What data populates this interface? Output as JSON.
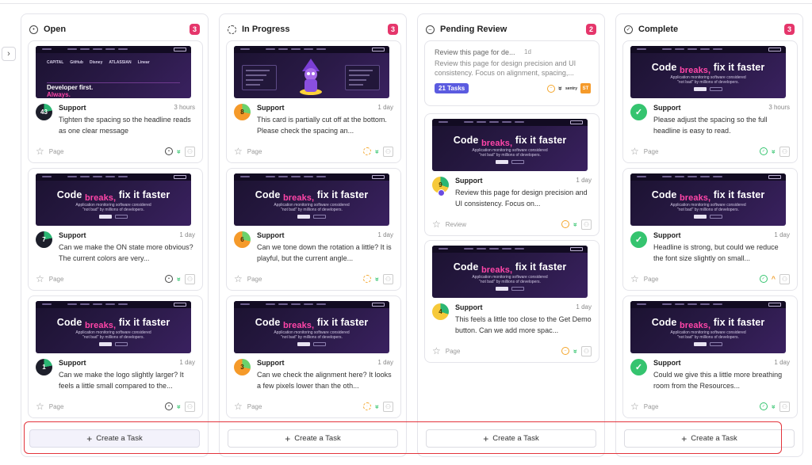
{
  "columns": [
    {
      "title": "Open",
      "icon": "open-status-icon",
      "count": "3",
      "create_label": "Create a Task",
      "cards": [
        {
          "thumb": "logos",
          "avatar": "43",
          "avatar_style": "dark",
          "category": "Support",
          "time": "3 hours",
          "description": "Tighten the spacing so the headline reads as one clear message",
          "type": "Page",
          "status": "open",
          "priority": "low"
        },
        {
          "thumb": "hero",
          "avatar": "7",
          "avatar_style": "dark",
          "category": "Support",
          "time": "1 day",
          "description": "Can we make the ON state more obvious? The current colors are very...",
          "type": "Page",
          "status": "open",
          "priority": "low"
        },
        {
          "thumb": "hero",
          "avatar": "1",
          "avatar_style": "dark",
          "category": "Support",
          "time": "1 day",
          "description": "Can we make the logo slightly larger? It feels a little small compared to the...",
          "type": "Page",
          "status": "open",
          "priority": "low"
        }
      ]
    },
    {
      "title": "In Progress",
      "icon": "in-progress-status-icon",
      "count": "3",
      "create_label": "Create a Task",
      "cards": [
        {
          "thumb": "mascot",
          "avatar": "8",
          "avatar_style": "orange",
          "category": "Support",
          "time": "1 day",
          "description": "This card is partially cut off at the bottom. Please check the spacing an...",
          "type": "Page",
          "status": "progress",
          "priority": "low"
        },
        {
          "thumb": "hero",
          "avatar": "6",
          "avatar_style": "orange",
          "category": "Support",
          "time": "1 day",
          "description": "Can we tone down the rotation a little? It is playful, but the current angle...",
          "type": "Page",
          "status": "progress",
          "priority": "low"
        },
        {
          "thumb": "hero",
          "avatar": "3",
          "avatar_style": "orange",
          "category": "Support",
          "time": "1 day",
          "description": "Can we check the alignment here? It looks a few pixels lower than the oth...",
          "type": "Page",
          "status": "progress",
          "priority": "low"
        }
      ]
    },
    {
      "title": "Pending Review",
      "icon": "pending-review-status-icon",
      "count": "2",
      "create_label": "Create a Task",
      "review_card": {
        "title": "Review this page for de...",
        "time": "1d",
        "description": "Review this page for design precision and UI consistency. Focus on alignment, spacing,...",
        "tasks": "21 Tasks",
        "assignee": "ST",
        "logo": "sentry"
      },
      "cards": [
        {
          "thumb": "hero",
          "avatar": "9",
          "avatar_style": "yellow",
          "category": "Support",
          "time": "1 day",
          "description": "Review this page for design precision and UI consistency. Focus on...",
          "type": "Review",
          "status": "pending",
          "priority": "low"
        },
        {
          "thumb": "hero",
          "avatar": "4",
          "avatar_style": "yellow",
          "category": "Support",
          "time": "1 day",
          "description": "This feels a little too close to the Get Demo button. Can we add more spac...",
          "type": "Page",
          "status": "pending",
          "priority": "low"
        }
      ]
    },
    {
      "title": "Complete",
      "icon": "complete-status-icon",
      "count": "3",
      "create_label": "Create a Task",
      "cards": [
        {
          "thumb": "hero",
          "avatar": "✓",
          "avatar_style": "green",
          "category": "Support",
          "time": "3 hours",
          "description": "Please adjust the spacing so the full headline is easy to read.",
          "type": "Page",
          "status": "done",
          "priority": "low"
        },
        {
          "thumb": "hero",
          "avatar": "✓",
          "avatar_style": "green",
          "category": "Support",
          "time": "1 day",
          "description": "Headline is strong, but could we reduce the font size slightly on small...",
          "type": "Page",
          "status": "done",
          "priority": "high"
        },
        {
          "thumb": "hero",
          "avatar": "✓",
          "avatar_style": "green",
          "category": "Support",
          "time": "1 day",
          "description": "Could we give this a little more breathing room from the Resources...",
          "type": "Page",
          "status": "done",
          "priority": "low"
        }
      ]
    }
  ],
  "hero": {
    "code": "Code",
    "breaks": "breaks,",
    "rest": "fix it faster",
    "sub1": "Application monitoring software considered",
    "sub2": "\"not bad\" by millions of developers."
  },
  "logos_thumb": {
    "logos": [
      "CAPITAL",
      "GitHub",
      "Disney",
      "ATLASSIAN",
      "Linear"
    ],
    "headline": "Developer first.",
    "accent": "Always."
  },
  "colors": {
    "accent_pink": "#ff45a8",
    "badge": "#e5366b",
    "highlight": "#e3343c",
    "tasks_badge": "#5b5be0",
    "done_green": "#35c46f",
    "progress_orange": "#f59a2a"
  }
}
